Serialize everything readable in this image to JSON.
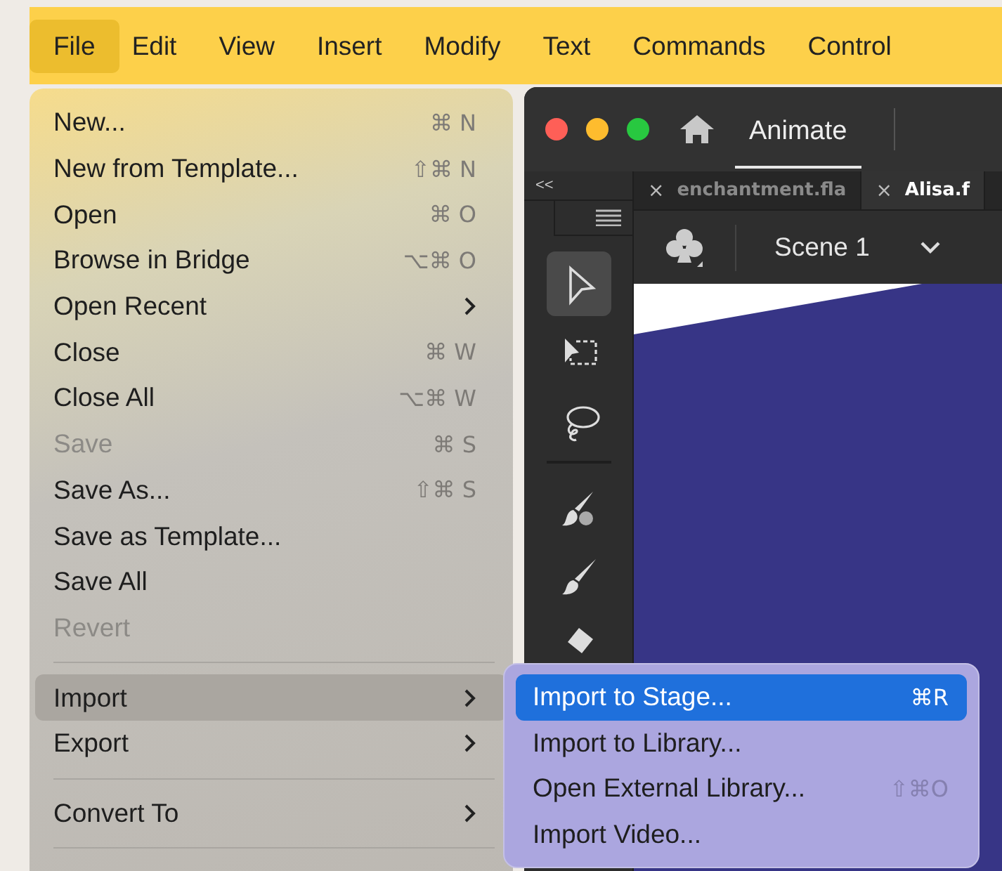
{
  "menu_bar": {
    "items": [
      {
        "label": "File",
        "selected": true
      },
      {
        "label": "Edit",
        "selected": false
      },
      {
        "label": "View",
        "selected": false
      },
      {
        "label": "Insert",
        "selected": false
      },
      {
        "label": "Modify",
        "selected": false
      },
      {
        "label": "Text",
        "selected": false
      },
      {
        "label": "Commands",
        "selected": false
      },
      {
        "label": "Control",
        "selected": false
      }
    ]
  },
  "app_window": {
    "home_tab": "Animate",
    "collapse_label": "<<",
    "document_tabs": [
      {
        "close": "×",
        "label": "enchantment.fla",
        "selected": false
      },
      {
        "close": "×",
        "label": "Alisa.f",
        "selected": true
      }
    ],
    "scene": "Scene 1",
    "tool_groups": [
      {
        "tools": [
          {
            "kind": "selection",
            "selected": true
          },
          {
            "kind": "subselection",
            "selected": false
          },
          {
            "kind": "lasso",
            "selected": false
          }
        ]
      },
      {
        "tools": [
          {
            "kind": "paint-brush",
            "selected": false
          },
          {
            "kind": "brush",
            "selected": false
          },
          {
            "kind": "eraser",
            "selected": false
          }
        ]
      }
    ]
  },
  "file_menu": {
    "items": [
      {
        "kind": "item",
        "label": "New...",
        "shortcut": "⌘ N",
        "disabled": false,
        "submenu": false,
        "selected": false
      },
      {
        "kind": "item",
        "label": "New from Template...",
        "shortcut": "⇧⌘ N",
        "disabled": false,
        "submenu": false,
        "selected": false
      },
      {
        "kind": "item",
        "label": "Open",
        "shortcut": "⌘ O",
        "disabled": false,
        "submenu": false,
        "selected": false
      },
      {
        "kind": "item",
        "label": "Browse in Bridge",
        "shortcut": "⌥⌘ O",
        "disabled": false,
        "submenu": false,
        "selected": false
      },
      {
        "kind": "item",
        "label": "Open Recent",
        "disabled": false,
        "submenu": true,
        "selected": false
      },
      {
        "kind": "item",
        "label": "Close",
        "shortcut": "⌘ W",
        "disabled": false,
        "submenu": false,
        "selected": false
      },
      {
        "kind": "item",
        "label": "Close All",
        "shortcut": "⌥⌘ W",
        "disabled": false,
        "submenu": false,
        "selected": false
      },
      {
        "kind": "item",
        "label": "Save",
        "shortcut": "⌘ S",
        "disabled": true,
        "submenu": false,
        "selected": false
      },
      {
        "kind": "item",
        "label": "Save As...",
        "shortcut": "⇧⌘ S",
        "disabled": false,
        "submenu": false,
        "selected": false
      },
      {
        "kind": "item",
        "label": "Save as Template...",
        "disabled": false,
        "submenu": false,
        "selected": false
      },
      {
        "kind": "item",
        "label": "Save All",
        "disabled": false,
        "submenu": false,
        "selected": false
      },
      {
        "kind": "item",
        "label": "Revert",
        "disabled": true,
        "submenu": false,
        "selected": false
      },
      {
        "kind": "separator"
      },
      {
        "kind": "item",
        "label": "Import",
        "disabled": false,
        "submenu": true,
        "selected": true
      },
      {
        "kind": "item",
        "label": "Export",
        "disabled": false,
        "submenu": true,
        "selected": false
      },
      {
        "kind": "separator"
      },
      {
        "kind": "item",
        "label": "Convert To",
        "disabled": false,
        "submenu": true,
        "selected": false
      },
      {
        "kind": "separator"
      }
    ]
  },
  "import_submenu": {
    "items": [
      {
        "label": "Import to Stage...",
        "shortcut": "⌘R",
        "selected": true
      },
      {
        "label": "Import to Library...",
        "selected": false
      },
      {
        "label": "Open External Library...",
        "shortcut": "⇧⌘O",
        "selected": false
      },
      {
        "label": "Import Video...",
        "selected": false
      }
    ]
  }
}
